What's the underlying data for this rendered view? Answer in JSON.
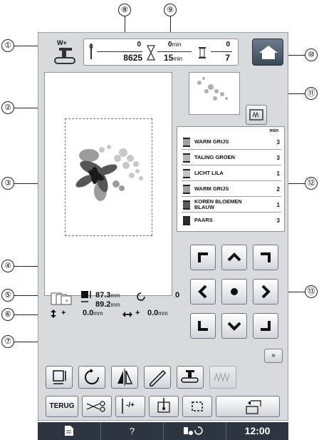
{
  "callouts": [
    "①",
    "②",
    "③",
    "④",
    "⑤",
    "⑥",
    "⑦",
    "⑧",
    "⑨",
    "⑩",
    "⑪",
    "⑫",
    "⑬"
  ],
  "counters": {
    "stitch_current": "0",
    "stitch_total": "8625",
    "time_current": "0",
    "time_current_unit": "min",
    "time_total": "15",
    "time_total_unit": "min",
    "color_current": "0",
    "color_total": "7"
  },
  "presser_label": "W+",
  "thread_list": {
    "header": "min",
    "rows": [
      {
        "name": "WARM GRIJS",
        "time": "3",
        "color": "#a0a0a0"
      },
      {
        "name": "TALING GROEN",
        "time": "3",
        "color": "#b5b5b5"
      },
      {
        "name": "LICHT LILA",
        "time": "1",
        "color": "#c4c4c4"
      },
      {
        "name": "WARM GRIJS",
        "time": "2",
        "color": "#a0a0a0"
      },
      {
        "name": "KOREN BLOEMEN BLAUW",
        "time": "1",
        "color": "#585858"
      },
      {
        "name": "PAARS",
        "time": "3",
        "color": "#2a2a2a"
      }
    ]
  },
  "dimensions": {
    "width_value": "87.3",
    "height_value": "89.2",
    "unit": "mm",
    "rotation": "0",
    "offset_v": "0.0",
    "offset_h": "0.0",
    "plus": "+"
  },
  "toolbar": {
    "collapse": "»",
    "back_label": "TERUG",
    "plusminus_label": "-/+"
  },
  "status": {
    "help": "?",
    "clock": "12:00"
  }
}
